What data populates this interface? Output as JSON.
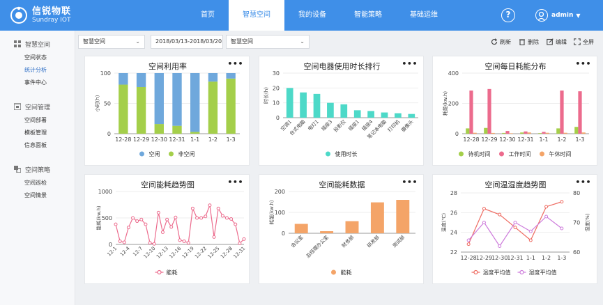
{
  "app": {
    "title_cn": "信锐物联",
    "title_en": "Sundray IOT"
  },
  "nav": [
    {
      "label": "首页",
      "active": false
    },
    {
      "label": "智慧空间",
      "active": true
    },
    {
      "label": "我的设备",
      "active": false
    },
    {
      "label": "智能策略",
      "active": false
    },
    {
      "label": "基础运维",
      "active": false
    }
  ],
  "header": {
    "help_label": "?",
    "username": "admin"
  },
  "sidebar": {
    "groups": [
      {
        "title": "智慧空间",
        "icon": "grid-icon",
        "items": [
          {
            "label": "空间状态"
          },
          {
            "label": "统计分析",
            "active": true
          },
          {
            "label": "事件中心"
          }
        ]
      },
      {
        "title": "空间管理",
        "icon": "building-icon",
        "items": [
          {
            "label": "空间部署"
          },
          {
            "label": "模板管理"
          },
          {
            "label": "信息面板"
          }
        ]
      },
      {
        "title": "空间策略",
        "icon": "layers-icon",
        "items": [
          {
            "label": "空间巡检"
          },
          {
            "label": "空间情景"
          }
        ]
      }
    ]
  },
  "toolbar": {
    "space_select": "智慧空间",
    "date_range": "2018/03/13-2018/03/20",
    "space_select2": "智慧空间",
    "refresh": "刷新",
    "delete": "删除",
    "edit": "编辑",
    "fullscreen": "全屏"
  },
  "colors": {
    "primary": "#3f8fe8",
    "blue": "#6fa8dc",
    "green": "#a4cf4a",
    "cyan": "#4dd9c8",
    "pink": "#ec6b8d",
    "orange": "#f4a468",
    "red": "#ee6a60",
    "purple": "#cd7bdb"
  },
  "charts": {
    "util": {
      "title": "空间利用率",
      "more": "•••",
      "chart_data": {
        "type": "bar",
        "stacked": true,
        "categories": [
          "12-28",
          "12-29",
          "12-30",
          "12-31",
          "1-1",
          "1-2",
          "1-3"
        ],
        "ylim": [
          0,
          100
        ],
        "yticks": [
          0,
          50,
          100
        ],
        "ylabel": "小时(h)",
        "series": [
          {
            "name": "空闲",
            "color": "#6fa8dc",
            "values": [
              19,
              23,
              84,
              87,
              97,
              14,
              9
            ]
          },
          {
            "name": "非空闲",
            "color": "#a4cf4a",
            "values": [
              81,
              77,
              16,
              13,
              3,
              86,
              91
            ]
          }
        ]
      }
    },
    "usage": {
      "title": "空间电器使用时长排行",
      "more": "•••",
      "chart_data": {
        "type": "bar",
        "categories": [
          "空调1",
          "台式电脑",
          "电灯1",
          "插座3",
          "投影仪",
          "插座1",
          "插座4",
          "笔记本电脑",
          "打印机",
          "摄像头"
        ],
        "values": [
          20,
          17,
          16,
          10,
          9,
          5,
          4.5,
          3.5,
          3,
          2.5
        ],
        "ylim": [
          0,
          30
        ],
        "yticks": [
          0,
          10,
          20,
          30
        ],
        "ylabel": "时长(h)",
        "series": [
          {
            "name": "使用时长",
            "color": "#4dd9c8"
          }
        ]
      }
    },
    "daily": {
      "title": "空间每日耗能分布",
      "more": "•••",
      "chart_data": {
        "type": "bar",
        "categories": [
          "12-28",
          "12-29",
          "12-30",
          "12-31",
          "1-1",
          "1-2",
          "1-3"
        ],
        "ylim": [
          0,
          400
        ],
        "yticks": [
          0,
          200,
          400
        ],
        "ylabel": "耗能(kw.h)",
        "series": [
          {
            "name": "待机时间",
            "color": "#a4cf4a",
            "values": [
              35,
              38,
              5,
              8,
              4,
              35,
              45
            ]
          },
          {
            "name": "工作时间",
            "color": "#ec6b8d",
            "values": [
              285,
              295,
              18,
              15,
              12,
              285,
              280
            ]
          },
          {
            "name": "午休时间",
            "color": "#f4a468",
            "values": [
              6,
              5,
              3,
              8,
              6,
              6,
              8
            ]
          }
        ]
      }
    },
    "trend": {
      "title": "空间能耗趋势图",
      "more": "•••",
      "chart_data": {
        "type": "line",
        "categories": [
          "12-1",
          "12-2",
          "12-3",
          "12-4",
          "12-5",
          "12-6",
          "12-7",
          "12-8",
          "12-9",
          "12-10",
          "12-11",
          "12-12",
          "12-13",
          "12-14",
          "12-15",
          "12-16",
          "12-17",
          "12-18",
          "12-19",
          "12-20",
          "12-21",
          "12-22",
          "12-23",
          "12-24",
          "12-25",
          "12-26",
          "12-27",
          "12-28",
          "12-29",
          "12-30",
          "12-31"
        ],
        "xticks": [
          "12-1",
          "12-4",
          "12-7",
          "12-10",
          "12-13",
          "12-16",
          "12-19",
          "12-22",
          "12-25",
          "12-28",
          "12-31"
        ],
        "values": [
          380,
          60,
          40,
          320,
          500,
          440,
          470,
          380,
          30,
          10,
          600,
          230,
          470,
          330,
          510,
          80,
          60,
          30,
          680,
          500,
          500,
          530,
          740,
          140,
          680,
          540,
          500,
          480,
          380,
          20,
          100
        ],
        "ylim": [
          0,
          1000
        ],
        "yticks": [
          0,
          500,
          1000
        ],
        "ylabel": "能耗(kw.h)",
        "series": [
          {
            "name": "能耗",
            "color": "#ec6b8d"
          }
        ]
      }
    },
    "energy": {
      "title": "空间能耗数据",
      "more": "•••",
      "chart_data": {
        "type": "bar",
        "categories": [
          "会议室",
          "总经理办公室",
          "财务部",
          "研发部",
          "测试部"
        ],
        "values": [
          45,
          10,
          58,
          148,
          160
        ],
        "ylim": [
          0,
          200
        ],
        "yticks": [
          0,
          100,
          200
        ],
        "ylabel": "耗能(kw.h)",
        "series": [
          {
            "name": "能耗",
            "color": "#f4a468"
          }
        ]
      }
    },
    "temp": {
      "title": "空间温湿度趋势图",
      "more": "•••",
      "chart_data": {
        "type": "line",
        "categories": [
          "12-28",
          "12-29",
          "12-30",
          "12-31",
          "1-1",
          "1-2",
          "1-3"
        ],
        "y_left": {
          "label": "温度(℃)",
          "ylim": [
            22,
            28
          ],
          "yticks": [
            22,
            24,
            26,
            28
          ]
        },
        "y_right": {
          "label": "湿度(%)",
          "ylim": [
            60,
            80
          ],
          "yticks": [
            60,
            70,
            80
          ]
        },
        "series": [
          {
            "name": "温度平均值",
            "color": "#ee6a60",
            "axis": "left",
            "values": [
              22.8,
              26.4,
              25.8,
              24.5,
              23.2,
              26.6,
              27.1
            ]
          },
          {
            "name": "湿度平均值",
            "color": "#cd7bdb",
            "axis": "right",
            "values": [
              64,
              70,
              62,
              70,
              67,
              72,
              68
            ]
          }
        ]
      }
    }
  }
}
